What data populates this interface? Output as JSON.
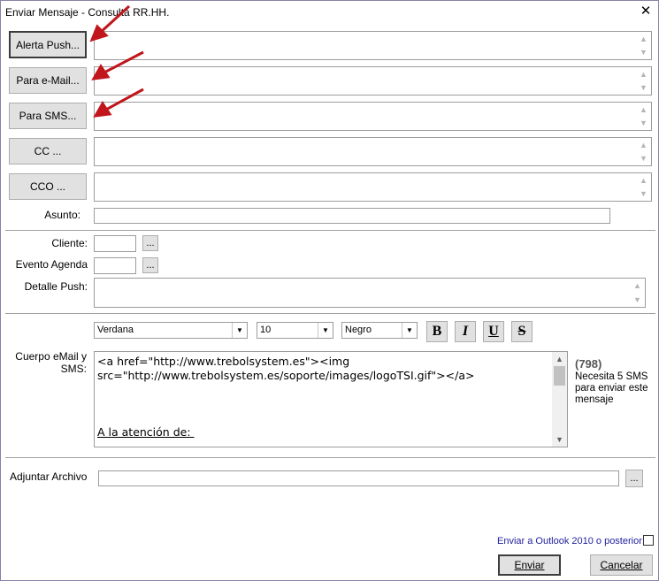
{
  "window": {
    "title": "Enviar Mensaje - Consulta RR.HH.",
    "close_label": "✕"
  },
  "recipients": {
    "push_button": "Alerta Push...",
    "email_button": "Para e-Mail...",
    "sms_button": "Para SMS...",
    "cc_button": "CC ...",
    "cco_button": "CCO ..."
  },
  "asunto": {
    "label": "Asunto:",
    "value": ""
  },
  "cliente": {
    "label": "Cliente:",
    "value": "",
    "browse_label": "..."
  },
  "evento": {
    "label": "Evento Agenda",
    "value": "",
    "browse_label": "..."
  },
  "detalle_push": {
    "label": "Detalle Push:",
    "value": ""
  },
  "formatting": {
    "font": "Verdana",
    "size": "10",
    "color": "Negro",
    "bold_label": "B",
    "italic_label": "I",
    "underline_label": "U",
    "strike_label": "S"
  },
  "cuerpo": {
    "label": "Cuerpo eMail y SMS:",
    "line1": "<a href=\"http://www.trebolsystem.es\"><img",
    "line2": "src=\"http://www.trebolsystem.es/soporte/images/logoTSI.gif\"></a>",
    "attention": "A la atención de: "
  },
  "sms_info": {
    "count": "(798)",
    "message": "Necesita 5 SMS para enviar este mensaje"
  },
  "adjuntar": {
    "label": "Adjuntar Archivo",
    "value": "",
    "browse_label": "..."
  },
  "outlook": {
    "label": "Enviar a Outlook 2010 o posterior:",
    "checked": false
  },
  "footer": {
    "send_label": "Enviar",
    "cancel_label": "Cancelar"
  },
  "colors": {
    "annotation_arrow": "#c0161c",
    "link_text": "#1f1f9e",
    "sms_count": "#555555"
  }
}
